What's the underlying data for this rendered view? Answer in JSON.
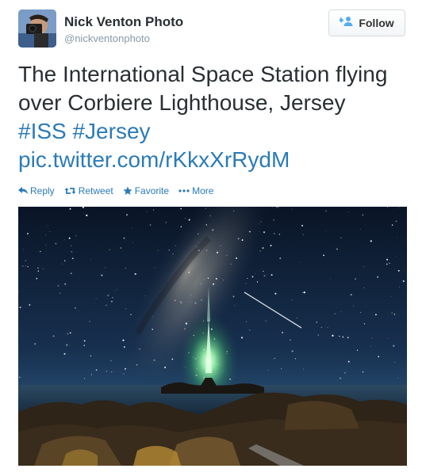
{
  "author": {
    "name": "Nick Venton Photo",
    "handle": "@nickventonphoto"
  },
  "follow_button": {
    "label": "Follow"
  },
  "tweet": {
    "line1": "The International Space Station flying",
    "line2": "over Corbiere Lighthouse, Jersey",
    "hashtag1": "#ISS",
    "hashtag2": "#Jersey",
    "link": "pic.twitter.com/rKkxXrRydM"
  },
  "actions": {
    "reply": "Reply",
    "retweet": "Retweet",
    "favorite": "Favorite",
    "more": "More"
  },
  "colors": {
    "link": "#2b7bb9",
    "text": "#292f33",
    "muted": "#8899a6"
  },
  "icons": {
    "follow": "add-user-icon",
    "reply": "reply-arrow-icon",
    "retweet": "retweet-icon",
    "favorite": "star-icon",
    "more": "ellipsis-icon"
  }
}
